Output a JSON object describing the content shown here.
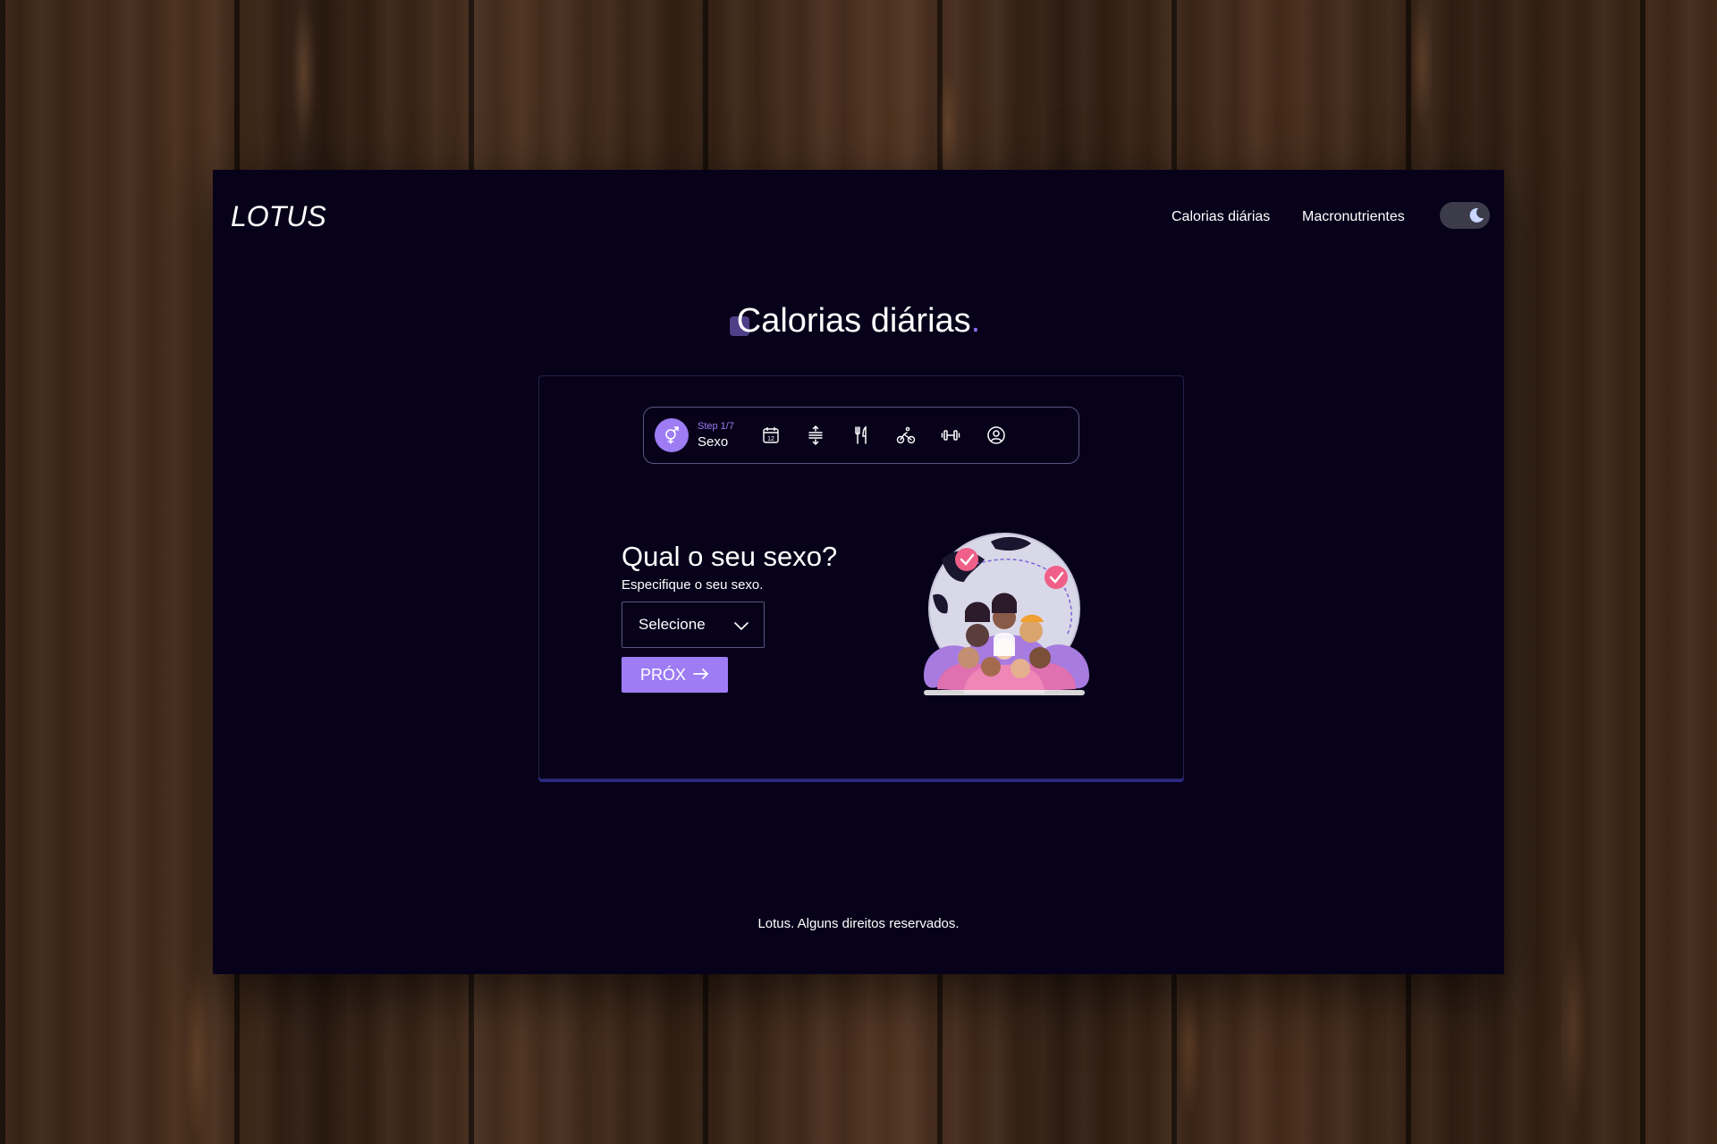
{
  "app": {
    "logo": "LOTUS"
  },
  "nav": {
    "items": [
      {
        "label": "Calorias diárias"
      },
      {
        "label": "Macronutrientes"
      }
    ],
    "theme_toggle": {
      "state": "dark",
      "icon": "moon-icon"
    }
  },
  "page": {
    "title": "Calorias diárias",
    "title_dot": "."
  },
  "stepper": {
    "current_step_label": "Step 1/7",
    "current_step_name": "Sexo",
    "icons": [
      "gender-icon",
      "calendar-icon",
      "height-icon",
      "utensils-icon",
      "bike-icon",
      "dumbbell-icon",
      "user-circle-icon"
    ]
  },
  "form": {
    "question": "Qual o seu sexo?",
    "hint": "Especifique o seu sexo.",
    "select_value": "Selecione",
    "next_label": "PRÓX"
  },
  "footer": {
    "text": "Lotus. Alguns direitos reservados."
  },
  "colors": {
    "background": "#07021a",
    "accent": "#9d7cf4",
    "border": "#5a5680"
  }
}
